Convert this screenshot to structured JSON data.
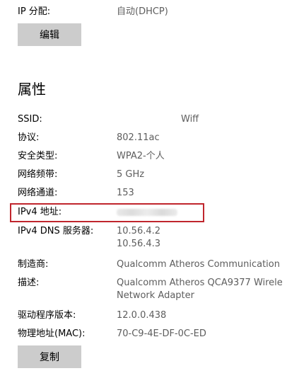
{
  "ip_settings": {
    "assignment_label": "IP 分配:",
    "assignment_value": "自动(DHCP)",
    "edit_button": "编辑"
  },
  "properties": {
    "title": "属性",
    "ssid_label": "SSID:",
    "ssid_value": "Wiff",
    "protocol_label": "协议:",
    "protocol_value": "802.11ac",
    "security_label": "安全类型:",
    "security_value": "WPA2-个人",
    "band_label": "网络频带:",
    "band_value": "5 GHz",
    "channel_label": "网络通道:",
    "channel_value": "153",
    "ipv4_label": "IPv4 地址:",
    "ipv4_value_state": "blurred",
    "dns_label": "IPv4 DNS 服务器:",
    "dns_values": [
      "10.56.4.2",
      "10.56.4.3"
    ],
    "manufacturer_label": "制造商:",
    "manufacturer_value": "Qualcomm Atheros Communication",
    "description_label": "描述:",
    "description_values": [
      "Qualcomm Atheros QCA9377 Wirele",
      "Network Adapter"
    ],
    "driver_label": "驱动程序版本:",
    "driver_value": "12.0.0.438",
    "mac_label": "物理地址(MAC):",
    "mac_value": "70-C9-4E-DF-0C-ED",
    "copy_button": "复制"
  },
  "colors": {
    "button_bg": "#cccccc",
    "value_text": "#5d5d5d",
    "highlight_border": "#c0262d"
  }
}
